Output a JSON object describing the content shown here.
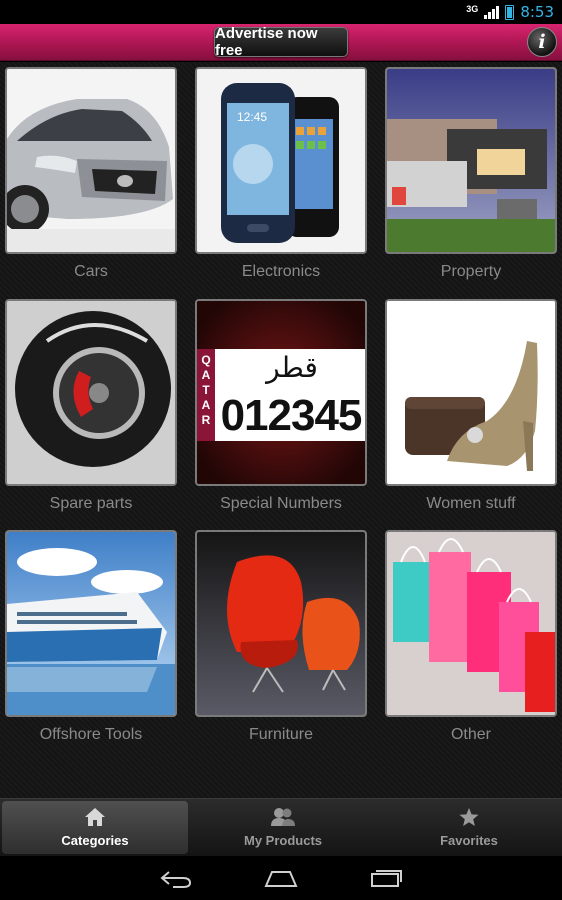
{
  "status_bar": {
    "network": "3G",
    "time": "8:53"
  },
  "header": {
    "advertise_label": "Advertise now free",
    "info_icon": "info-icon"
  },
  "categories": [
    {
      "label": "Cars"
    },
    {
      "label": "Electronics"
    },
    {
      "label": "Property"
    },
    {
      "label": "Spare parts"
    },
    {
      "label": "Special Numbers",
      "plate_country": "QATAR",
      "plate_arabic": "قطر",
      "plate_number": "012345"
    },
    {
      "label": "Women stuff"
    },
    {
      "label": "Offshore Tools"
    },
    {
      "label": "Furniture"
    },
    {
      "label": "Other"
    }
  ],
  "tabs": [
    {
      "label": "Categories",
      "icon": "home-icon",
      "active": true
    },
    {
      "label": "My Products",
      "icon": "users-icon",
      "active": false
    },
    {
      "label": "Favorites",
      "icon": "star-icon",
      "active": false
    }
  ],
  "nav": {
    "back_icon": "back-icon",
    "home_icon": "home-nav-icon",
    "recents_icon": "recents-icon"
  },
  "colors": {
    "header": "#a8154f",
    "accent": "#33b5e5"
  }
}
